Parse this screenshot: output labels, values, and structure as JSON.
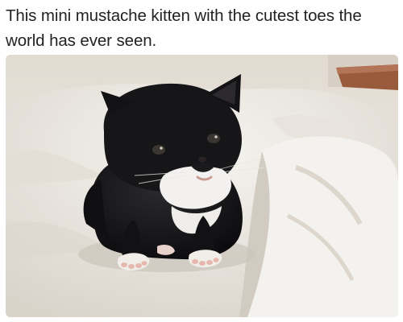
{
  "tweet": {
    "text": "This mini mustache kitten with the cutest toes the world has ever seen."
  },
  "photo": {
    "subject": "black-and-white kitten on a white blanket",
    "colors": {
      "blanket": "#efece7",
      "blanket_shadow": "#d6d0c7",
      "wall": "#e6e0d8",
      "wood": "#9a5a3c",
      "fur_black": "#141416",
      "fur_white": "#f2f1ef",
      "toe_pink": "#e6b7ae"
    }
  }
}
